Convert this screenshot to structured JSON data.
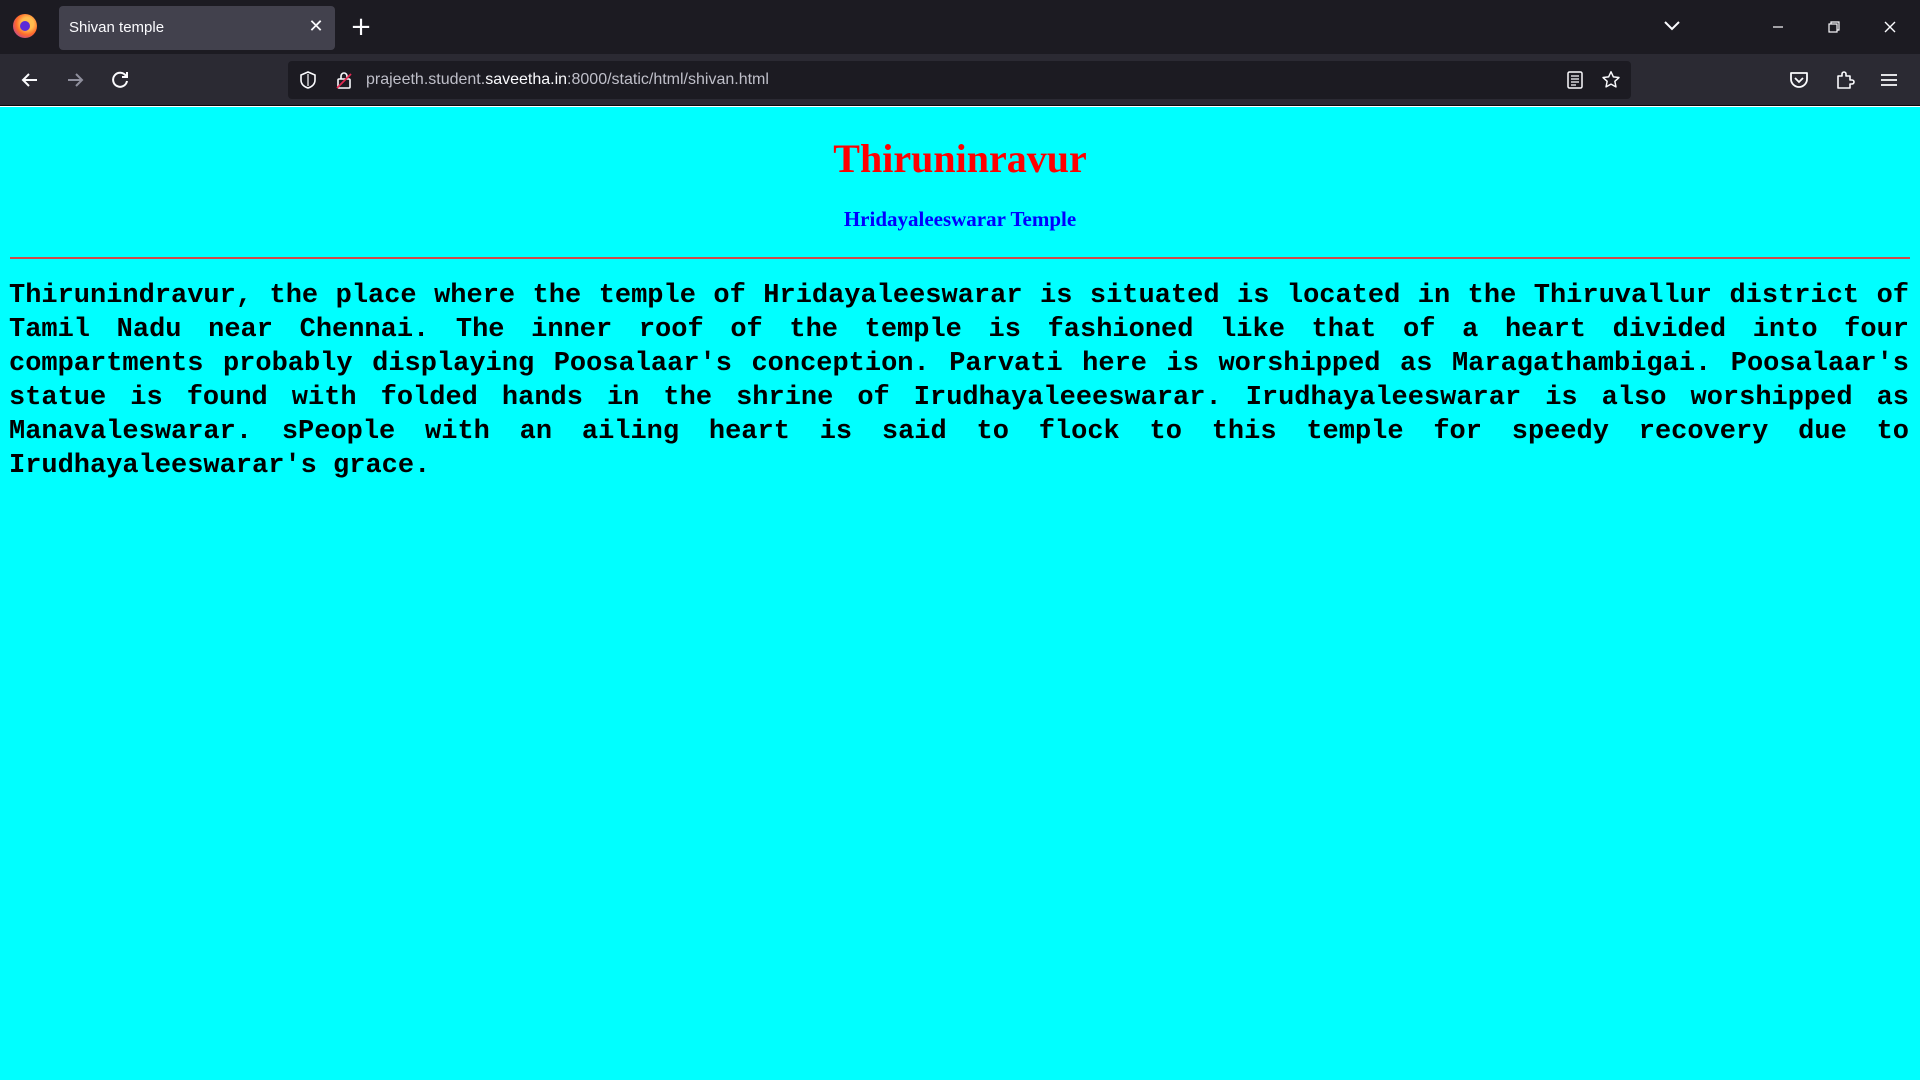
{
  "browser": {
    "tab_title": "Shivan temple",
    "url_prefix": "prajeeth.student.",
    "url_domain": "saveetha.in",
    "url_suffix": ":8000/static/html/shivan.html"
  },
  "page": {
    "background_color": "#00ffff",
    "heading": "Thiruninravur",
    "heading_color": "#ff0000",
    "subheading": "Hridayaleeswarar Temple",
    "subheading_color": "#0000ff",
    "body": "Thirunindravur, the place where the temple of Hridayaleeswarar is situated is located in the Thiruvallur district of Tamil Nadu near Chennai. The inner roof of the temple is fashioned like that of a heart divided into four compartments probably displaying Poosalaar's conception. Parvati here is worshipped as Maragathambigai. Poosalaar's statue is found with folded hands in the shrine of Irudhayaleeeswarar. Irudhayaleeswarar is also worshipped as Manavaleswarar. sPeople with an ailing heart is said to flock to this temple for speedy recovery due to Irudhayaleeswarar's grace."
  }
}
